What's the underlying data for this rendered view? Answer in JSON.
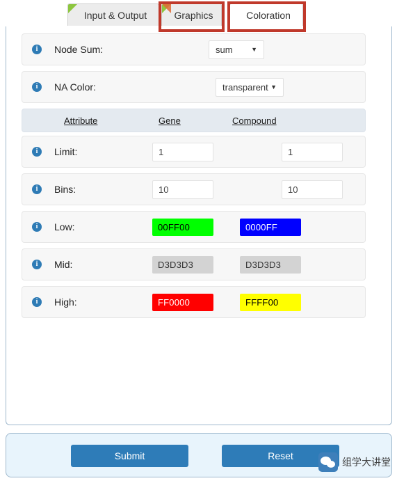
{
  "tabs": [
    {
      "label": "Input & Output",
      "active": false,
      "corner": "green-triangle-icon"
    },
    {
      "label": "Graphics",
      "active": false,
      "corner": "orange-triangle-icon"
    },
    {
      "label": "Coloration",
      "active": true,
      "corner": "none"
    }
  ],
  "annotations": {
    "color": "#c0392b",
    "boxes": [
      "graphics-tab",
      "coloration-tab"
    ]
  },
  "form": {
    "info_icon": "i",
    "node_sum": {
      "label": "Node Sum:",
      "value": "sum",
      "caret": "▼"
    },
    "na_color": {
      "label": "NA Color:",
      "value": "transparent",
      "caret": "▼"
    },
    "columns": {
      "attribute": "Attribute",
      "gene": "Gene",
      "compound": "Compound"
    },
    "limit": {
      "label": "Limit:",
      "gene": "1",
      "compound": "1"
    },
    "bins": {
      "label": "Bins:",
      "gene": "10",
      "compound": "10"
    },
    "low": {
      "label": "Low:",
      "gene_value": "00FF00",
      "gene_color": "#00FF00",
      "gene_text_color": "#000000",
      "compound_value": "0000FF",
      "compound_color": "#0000FF",
      "compound_text_color": "#FFFFFF"
    },
    "mid": {
      "label": "Mid:",
      "gene_value": "D3D3D3",
      "gene_color": "#D3D3D3",
      "gene_text_color": "#333333",
      "compound_value": "D3D3D3",
      "compound_color": "#D3D3D3",
      "compound_text_color": "#333333"
    },
    "high": {
      "label": "High:",
      "gene_value": "FF0000",
      "gene_color": "#FF0000",
      "gene_text_color": "#FFFFFF",
      "compound_value": "FFFF00",
      "compound_color": "#FFFF00",
      "compound_text_color": "#000000"
    }
  },
  "footer": {
    "submit_label": "Submit",
    "reset_label": "Reset",
    "button_color": "#2e7cb8"
  },
  "watermark": {
    "icon": "wechat-icon",
    "text": "组学大讲堂"
  }
}
